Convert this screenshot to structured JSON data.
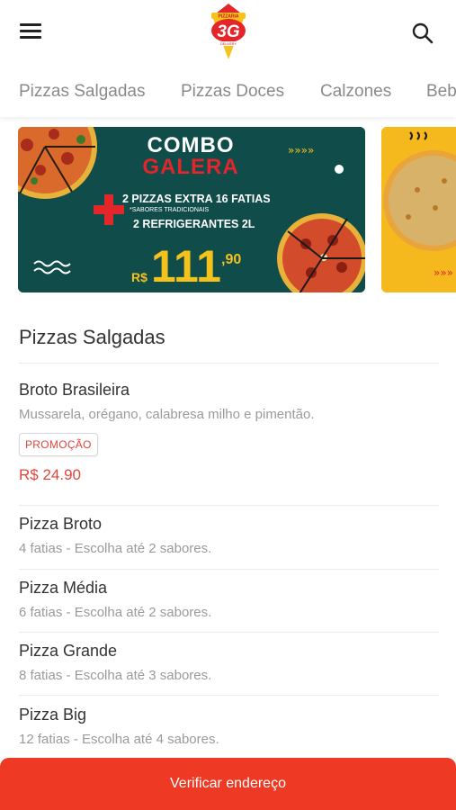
{
  "header": {
    "menu_icon": "hamburger-menu-icon",
    "logo_text": "3G",
    "logo_top_text": "PIZZARIA",
    "logo_bottom_text": "DELIVERY",
    "search_icon": "search-icon"
  },
  "categories": [
    "Pizzas Salgadas",
    "Pizzas Doces",
    "Calzones",
    "Beb"
  ],
  "banner": {
    "title_line1": "COMBO",
    "title_line2": "GALERA",
    "offer_line1": "2 PIZZAS EXTRA 16 FATIAS",
    "offer_note": "*SABORES TRADICIONAIS",
    "offer_line2": "2 REFRIGERANTES 2L",
    "currency": "R$",
    "price_main": "111",
    "price_cents": ",90",
    "arrows": "»»»»",
    "colors": {
      "background": "#0f4c4a",
      "title_red": "#e3262a",
      "price_yellow": "#f5c21b"
    }
  },
  "banner2": {
    "arrows": "»»»",
    "colors": {
      "background": "#f5b91e"
    }
  },
  "section": {
    "title": "Pizzas Salgadas"
  },
  "items": [
    {
      "name": "Broto Brasileira",
      "description": "Mussarela, orégano, calabresa milho e pimentão.",
      "badge": "PROMOÇÃO",
      "price": "R$ 24.90"
    },
    {
      "name": "Pizza Broto",
      "description": "4 fatias - Escolha até 2 sabores."
    },
    {
      "name": "Pizza Média",
      "description": "6 fatias - Escolha até 2 sabores."
    },
    {
      "name": "Pizza Grande",
      "description": "8 fatias - Escolha até 3 sabores."
    },
    {
      "name": "Pizza Big",
      "description": "12 fatias - Escolha até 4 sabores."
    }
  ],
  "cta": {
    "label": "Verificar endereço",
    "color": "#ee3a24"
  }
}
